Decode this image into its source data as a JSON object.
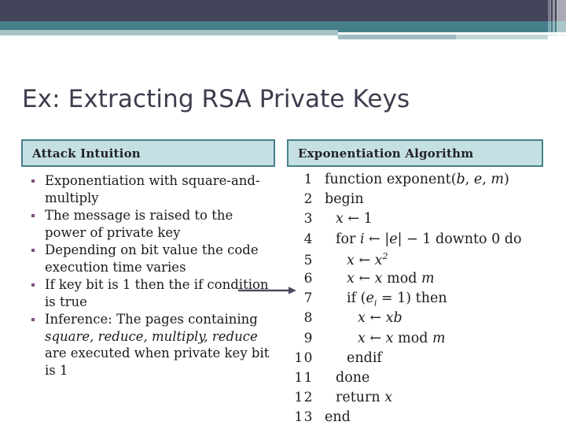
{
  "banner": {
    "colors": {
      "navy": "#434459",
      "teal": "#45808a",
      "light_blue": "#a7c3c8",
      "pale_blue": "#c3d7da"
    }
  },
  "slide": {
    "title": "Ex: Extracting RSA Private Keys"
  },
  "left_column": {
    "header": "Attack Intuition",
    "bullets": [
      {
        "parts": [
          {
            "text": "Exponentiation with square-and-multiply",
            "italic": false
          }
        ]
      },
      {
        "parts": [
          {
            "text": "The message is raised to the power of private key",
            "italic": false
          }
        ]
      },
      {
        "parts": [
          {
            "text": "Depending on bit value the code execution time varies",
            "italic": false
          }
        ]
      },
      {
        "parts": [
          {
            "text": "If key bit is 1 then the if condition is true",
            "italic": false
          }
        ]
      },
      {
        "parts": [
          {
            "text": "Inference: The pages containing ",
            "italic": false
          },
          {
            "text": "square, reduce, multiply, reduce",
            "italic": true
          },
          {
            "text": " are executed when private key bit is 1",
            "italic": false
          }
        ]
      }
    ]
  },
  "right_column": {
    "header": "Exponentiation Algorithm",
    "arrow": {
      "target_line": "7",
      "color": "#4a4b63"
    },
    "algorithm": [
      {
        "num": "1",
        "indent": 0,
        "code": "function exponent(<i>b</i>, <i>e</i>, <i>m</i>)",
        "plain": "function exponent(b, e, m)"
      },
      {
        "num": "2",
        "indent": 0,
        "code": "begin",
        "plain": "begin"
      },
      {
        "num": "3",
        "indent": 1,
        "code": "<i>x</i> &#8592; 1",
        "plain": "x <- 1"
      },
      {
        "num": "4",
        "indent": 1,
        "code": "for <i>i</i> &#8592; |<i>e</i>| &#8722; 1 downto 0 do",
        "plain": "for i <- |e| - 1 downto 0 do"
      },
      {
        "num": "5",
        "indent": 2,
        "code": "<i>x</i> &#8592; <i>x</i><sup>2</sup>",
        "plain": "x <- x^2"
      },
      {
        "num": "6",
        "indent": 2,
        "code": "<i>x</i> &#8592; <i>x</i> mod <i>m</i>",
        "plain": "x <- x mod m"
      },
      {
        "num": "7",
        "indent": 2,
        "code": "if (<i>e</i><sub>i</sub> = 1) then",
        "plain": "if (e_i = 1) then"
      },
      {
        "num": "8",
        "indent": 3,
        "code": "<i>x</i> &#8592; <i>xb</i>",
        "plain": "x <- xb"
      },
      {
        "num": "9",
        "indent": 3,
        "code": "<i>x</i> &#8592; <i>x</i> mod <i>m</i>",
        "plain": "x <- x mod m"
      },
      {
        "num": "10",
        "indent": 2,
        "code": "endif",
        "plain": "endif"
      },
      {
        "num": "11",
        "indent": 1,
        "code": "done",
        "plain": "done"
      },
      {
        "num": "12",
        "indent": 1,
        "code": "return <i>x</i>",
        "plain": "return x"
      },
      {
        "num": "13",
        "indent": 0,
        "code": "end",
        "plain": "end"
      }
    ]
  }
}
